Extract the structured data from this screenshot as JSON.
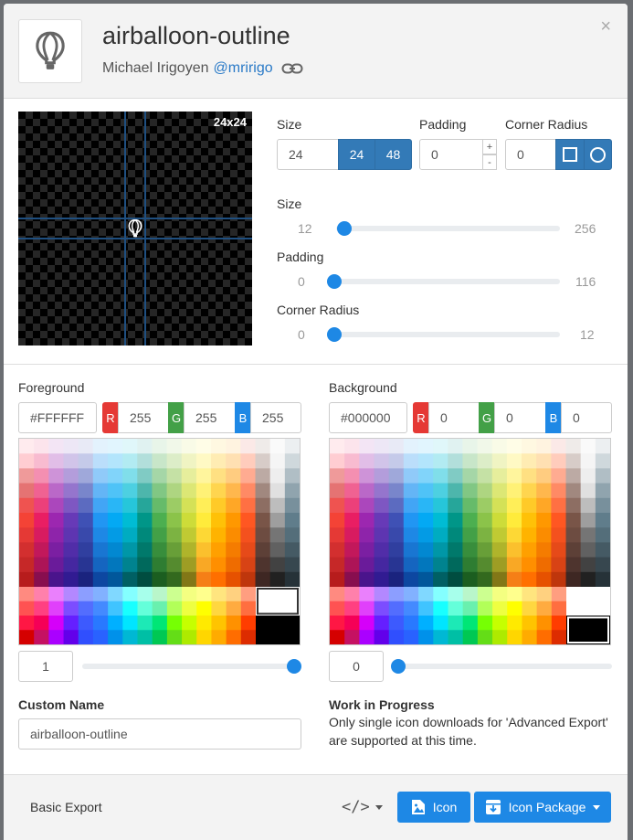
{
  "header": {
    "title": "airballoon-outline",
    "author": "Michael Irigoyen",
    "handle": "@mririgo",
    "close": "×"
  },
  "preview": {
    "size_label": "24x24"
  },
  "size": {
    "label": "Size",
    "value": "24",
    "opt1": "24",
    "opt2": "48"
  },
  "padding": {
    "label": "Padding",
    "value": "0",
    "up": "+",
    "down": "-"
  },
  "corner": {
    "label": "Corner Radius",
    "value": "0"
  },
  "sliders": [
    {
      "label": "Size",
      "min": "12",
      "max": "256",
      "level": 0
    },
    {
      "label": "Padding",
      "min": "0",
      "max": "116",
      "level": 0
    },
    {
      "label": "Corner Radius",
      "min": "0",
      "max": "12",
      "level": 0
    }
  ],
  "foreground": {
    "label": "Foreground",
    "hex": "#FFFFFF",
    "r_label": "R",
    "r": "255",
    "g_label": "G",
    "g": "255",
    "b_label": "B",
    "b": "255",
    "opacity": "1",
    "opacity_level": 1
  },
  "background": {
    "label": "Background",
    "hex": "#000000",
    "r_label": "R",
    "r": "0",
    "g_label": "G",
    "g": "0",
    "b_label": "B",
    "b": "0",
    "opacity": "0",
    "opacity_level": 0
  },
  "custom_name": {
    "label": "Custom Name",
    "value": "airballoon-outline"
  },
  "wip": {
    "title": "Work in Progress",
    "text": "Only single icon downloads for 'Advanced Export' are supported at this time."
  },
  "footer": {
    "basic_export": "Basic Export",
    "code": "</>",
    "icon_btn": "Icon",
    "package_btn": "Icon Package"
  },
  "colors": {
    "accent": "#1e88e5",
    "red": "#e53935",
    "green": "#43a047",
    "blue": "#1e88e5",
    "palette_main": [
      [
        "#ffebee",
        "#fce4ec",
        "#f3e5f5",
        "#ede7f6",
        "#e8eaf6",
        "#e3f2fd",
        "#e1f5fe",
        "#e0f7fa",
        "#e0f2f1",
        "#e8f5e9",
        "#f1f8e9",
        "#f9fbe7",
        "#fffde7",
        "#fff8e1",
        "#fff3e0",
        "#fbe9e7",
        "#efebe9",
        "#fafafa",
        "#eceff1"
      ],
      [
        "#ffcdd2",
        "#f8bbd0",
        "#e1bee7",
        "#d1c4e9",
        "#c5cae9",
        "#bbdefb",
        "#b3e5fc",
        "#b2ebf2",
        "#b2dfdb",
        "#c8e6c9",
        "#dcedc8",
        "#f0f4c3",
        "#fff9c4",
        "#ffecb3",
        "#ffe0b2",
        "#ffccbc",
        "#d7ccc8",
        "#f5f5f5",
        "#cfd8dc"
      ],
      [
        "#ef9a9a",
        "#f48fb1",
        "#ce93d8",
        "#b39ddb",
        "#9fa8da",
        "#90caf9",
        "#81d4fa",
        "#80deea",
        "#80cbc4",
        "#a5d6a7",
        "#c5e1a5",
        "#e6ee9c",
        "#fff59d",
        "#ffe082",
        "#ffcc80",
        "#ffab91",
        "#bcaaa4",
        "#eeeeee",
        "#b0bec5"
      ],
      [
        "#e57373",
        "#f06292",
        "#ba68c8",
        "#9575cd",
        "#7986cb",
        "#64b5f6",
        "#4fc3f7",
        "#4dd0e1",
        "#4db6ac",
        "#81c784",
        "#aed581",
        "#dce775",
        "#fff176",
        "#ffd54f",
        "#ffb74d",
        "#ff8a65",
        "#a1887f",
        "#e0e0e0",
        "#90a4ae"
      ],
      [
        "#ef5350",
        "#ec407a",
        "#ab47bc",
        "#7e57c2",
        "#5c6bc0",
        "#42a5f5",
        "#29b6f6",
        "#26c6da",
        "#26a69a",
        "#66bb6a",
        "#9ccc65",
        "#d4e157",
        "#ffee58",
        "#ffca28",
        "#ffa726",
        "#ff7043",
        "#8d6e63",
        "#bdbdbd",
        "#78909c"
      ],
      [
        "#f44336",
        "#e91e63",
        "#9c27b0",
        "#673ab7",
        "#3f51b5",
        "#2196f3",
        "#03a9f4",
        "#00bcd4",
        "#009688",
        "#4caf50",
        "#8bc34a",
        "#cddc39",
        "#ffeb3b",
        "#ffc107",
        "#ff9800",
        "#ff5722",
        "#795548",
        "#9e9e9e",
        "#607d8b"
      ],
      [
        "#e53935",
        "#d81b60",
        "#8e24aa",
        "#5e35b1",
        "#3949ab",
        "#1e88e5",
        "#039be5",
        "#00acc1",
        "#00897b",
        "#43a047",
        "#7cb342",
        "#c0ca33",
        "#fdd835",
        "#ffb300",
        "#fb8c00",
        "#f4511e",
        "#6d4c41",
        "#757575",
        "#546e7a"
      ],
      [
        "#d32f2f",
        "#c2185b",
        "#7b1fa2",
        "#512da8",
        "#303f9f",
        "#1976d2",
        "#0288d1",
        "#0097a7",
        "#00796b",
        "#388e3c",
        "#689f38",
        "#afb42b",
        "#fbc02d",
        "#ffa000",
        "#f57c00",
        "#e64a19",
        "#5d4037",
        "#616161",
        "#455a64"
      ],
      [
        "#c62828",
        "#ad1457",
        "#6a1b9a",
        "#4527a0",
        "#283593",
        "#1565c0",
        "#0277bd",
        "#00838f",
        "#00695c",
        "#2e7d32",
        "#558b2f",
        "#9e9d24",
        "#f9a825",
        "#ff8f00",
        "#ef6c00",
        "#d84315",
        "#4e342e",
        "#424242",
        "#37474f"
      ],
      [
        "#b71c1c",
        "#880e4f",
        "#4a148c",
        "#311b92",
        "#1a237e",
        "#0d47a1",
        "#01579b",
        "#006064",
        "#004d40",
        "#1b5e20",
        "#33691e",
        "#827717",
        "#f57f17",
        "#ff6f00",
        "#e65100",
        "#bf360c",
        "#3e2723",
        "#212121",
        "#263238"
      ]
    ],
    "palette_accent": [
      [
        "#ff8a80",
        "#ff80ab",
        "#ea80fc",
        "#b388ff",
        "#8c9eff",
        "#82b1ff",
        "#80d8ff",
        "#84ffff",
        "#a7ffeb",
        "#b9f6ca",
        "#ccff90",
        "#f4ff81",
        "#ffff8d",
        "#ffe57f",
        "#ffd180",
        "#ff9e80"
      ],
      [
        "#ff5252",
        "#ff4081",
        "#e040fb",
        "#7c4dff",
        "#536dfe",
        "#448aff",
        "#40c4ff",
        "#18ffff",
        "#64ffda",
        "#69f0ae",
        "#b2ff59",
        "#eeff41",
        "#ffff00",
        "#ffd740",
        "#ffab40",
        "#ff6e40"
      ],
      [
        "#ff1744",
        "#f50057",
        "#d500f9",
        "#651fff",
        "#3d5afe",
        "#2979ff",
        "#00b0ff",
        "#00e5ff",
        "#1de9b6",
        "#00e676",
        "#76ff03",
        "#c6ff00",
        "#ffea00",
        "#ffc400",
        "#ff9100",
        "#ff3d00"
      ],
      [
        "#d50000",
        "#c51162",
        "#aa00ff",
        "#6200ea",
        "#304ffe",
        "#2962ff",
        "#0091ea",
        "#00b8d4",
        "#00bfa5",
        "#00c853",
        "#64dd17",
        "#aeea00",
        "#ffd600",
        "#ffab00",
        "#ff6d00",
        "#dd2c00"
      ]
    ]
  }
}
